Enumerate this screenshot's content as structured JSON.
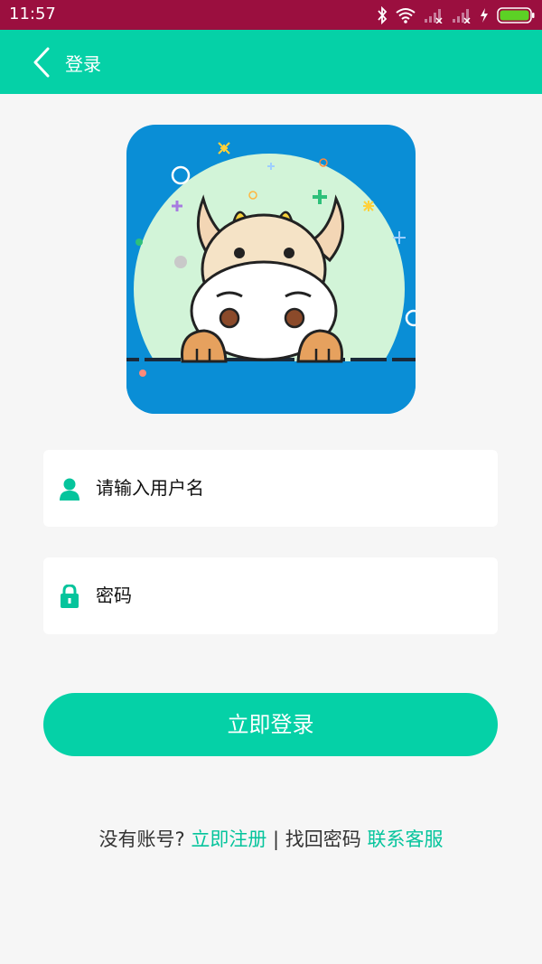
{
  "status_bar": {
    "time": "11:57",
    "icons": [
      "bluetooth-icon",
      "wifi-icon",
      "signal-icon",
      "signal-icon",
      "charging-icon",
      "battery-icon"
    ]
  },
  "app_bar": {
    "title": "登录",
    "back_icon": "chevron-left-icon"
  },
  "hero": {
    "image": "cow-mascot-illustration"
  },
  "form": {
    "username_placeholder": "请输入用户名",
    "password_placeholder": "密码"
  },
  "login_button": "立即登录",
  "links": {
    "no_account": "没有账号?",
    "register": "立即注册",
    "separator": " | ",
    "find_password": "找回密码",
    "contact_service": "联系客服"
  },
  "colors": {
    "primary": "#05d1a7",
    "status_bar": "#9b0f3f",
    "background": "#f6f6f6",
    "hero_bg": "#0a8ed6"
  }
}
